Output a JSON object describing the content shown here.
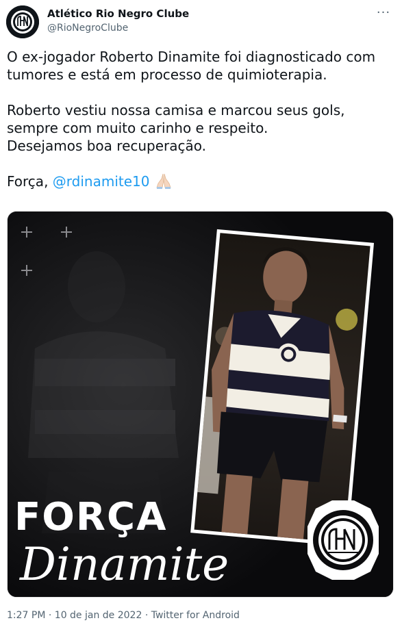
{
  "tweet": {
    "author_name": "Atlético Rio Negro Clube",
    "author_handle": "@RioNegroClube",
    "more_label": "···",
    "paragraph1": "O ex-jogador Roberto Dinamite foi diagnosticado com tumores e está em processo de quimioterapia.",
    "paragraph2_line1": "Roberto vestiu nossa camisa e marcou seus gols,",
    "paragraph2_line2": "sempre com muito carinho e respeito.",
    "paragraph2_line3": "Desejamos boa recuperação.",
    "paragraph3_prefix": "Força, ",
    "mention": "@rdinamite10",
    "emoji": "folded-hands",
    "time": "1:27 PM",
    "date": "10 de jan de 2022",
    "source": "Twitter for Android",
    "separator": "·"
  },
  "image": {
    "headline": "FORÇA",
    "script_text": "Dinamite",
    "badge_icon": "club-crest",
    "colors": {
      "background": "#09090b",
      "mention": "#1d9bf0",
      "secondary_text": "#536471"
    }
  }
}
